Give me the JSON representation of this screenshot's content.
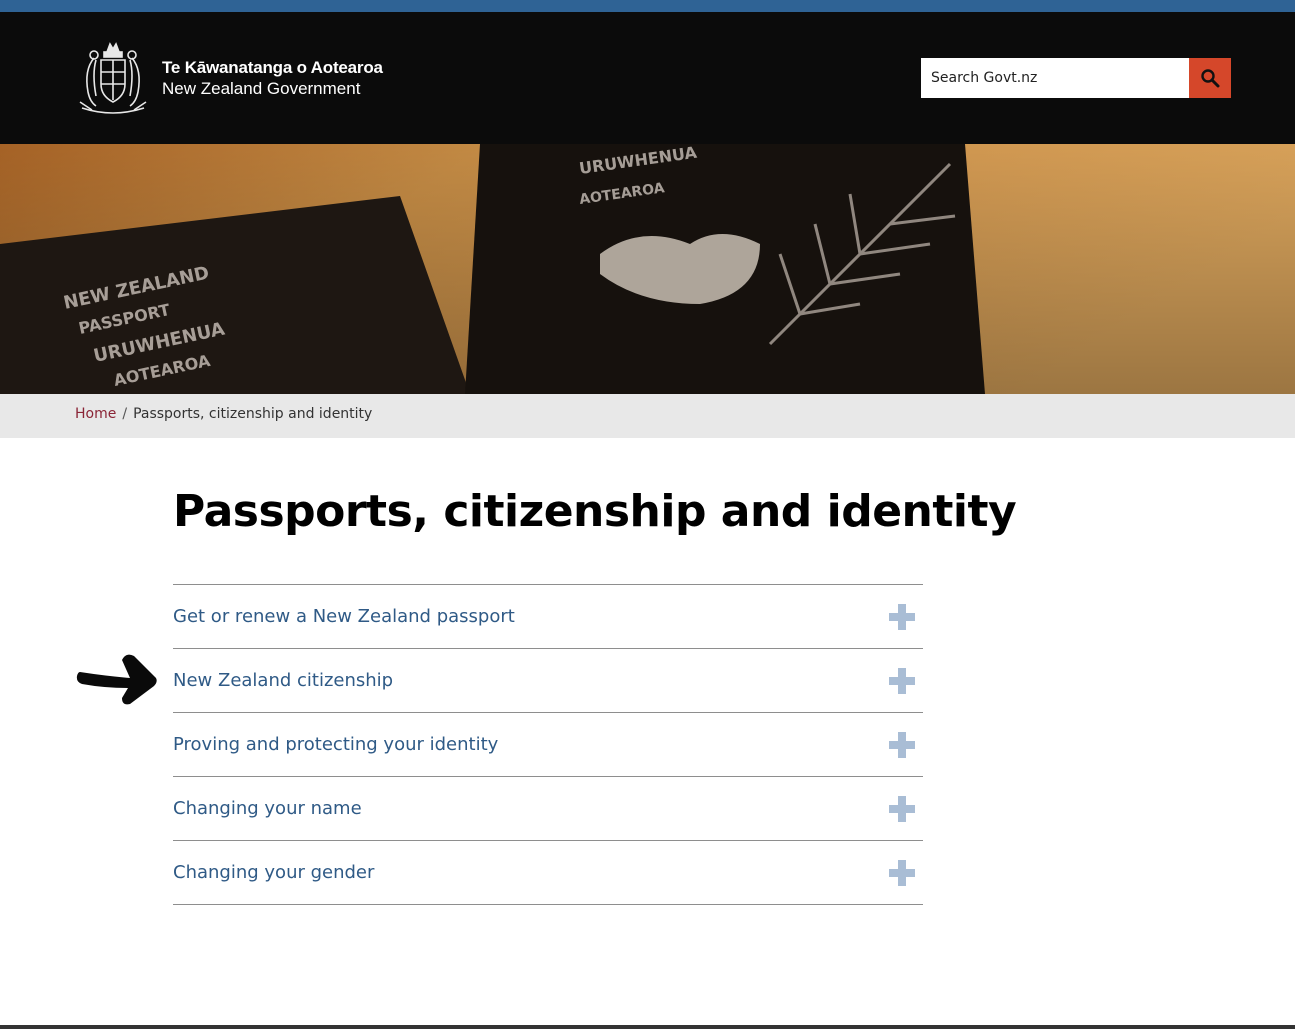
{
  "header": {
    "logo_maori": "Te Kāwanatanga o Aotearoa",
    "logo_english": "New Zealand Government",
    "search_placeholder": "Search Govt.nz",
    "search_button_icon": "search-icon",
    "accent_color": "#d5472a",
    "stripe_color": "#2f6395"
  },
  "breadcrumb": {
    "home": "Home",
    "separator": "/",
    "current": "Passports, citizenship and identity"
  },
  "page": {
    "title": "Passports, citizenship and identity"
  },
  "accordion": {
    "items": [
      {
        "label": "Get or renew a New Zealand passport",
        "icon": "plus-icon"
      },
      {
        "label": "New Zealand citizenship",
        "icon": "plus-icon"
      },
      {
        "label": "Proving and protecting your identity",
        "icon": "plus-icon"
      },
      {
        "label": "Changing your name",
        "icon": "plus-icon"
      },
      {
        "label": "Changing your gender",
        "icon": "plus-icon"
      }
    ]
  },
  "hero": {
    "image_text": [
      "NEW ZEALAND",
      "PASSPORT",
      "URUWHENUA",
      "AOTEAROA"
    ]
  }
}
